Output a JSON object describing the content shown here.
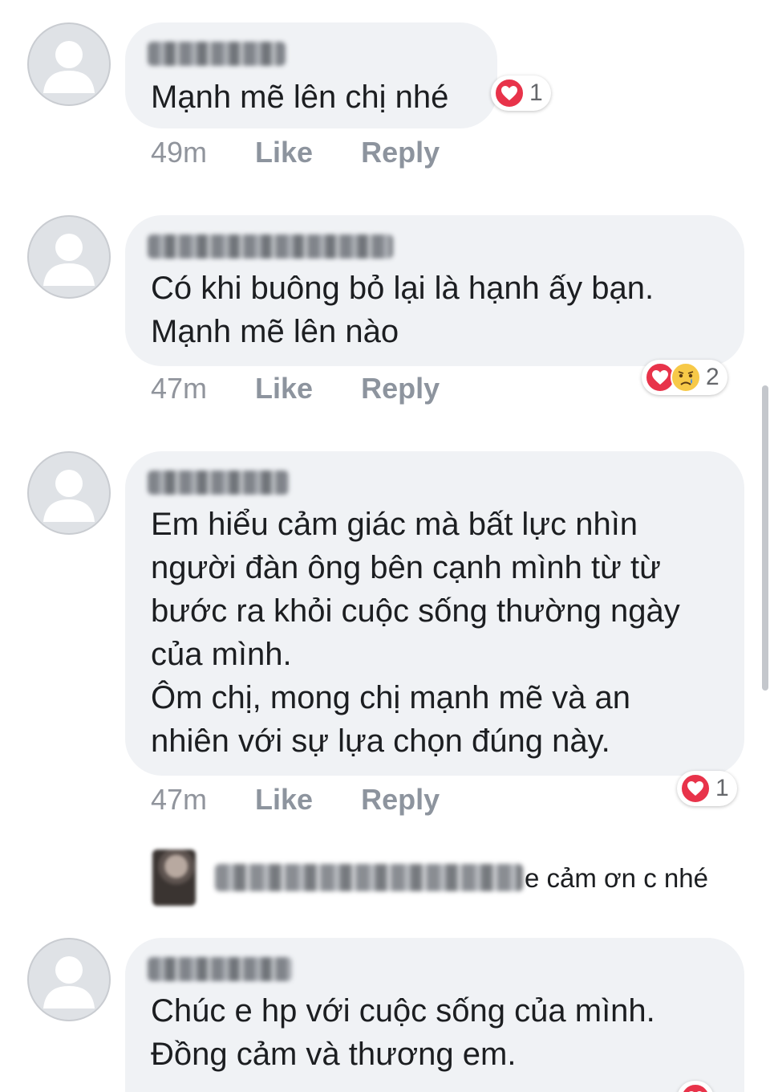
{
  "colors": {
    "bubble_bg": "#f0f2f5",
    "love_red": "#e8334a",
    "sad_yellow": "#f7c948",
    "meta_gray": "#90949c"
  },
  "comments": [
    {
      "text": "Mạnh mẽ lên chị nhé",
      "time": "49m",
      "like_label": "Like",
      "reply_label": "Reply",
      "reactions": [
        "love-icon"
      ],
      "reaction_count": "1"
    },
    {
      "text": "Có khi buông bỏ lại là hạnh ấy bạn.\nMạnh mẽ lên nào",
      "time": "47m",
      "like_label": "Like",
      "reply_label": "Reply",
      "reactions": [
        "love-icon",
        "sad-icon"
      ],
      "reaction_count": "2"
    },
    {
      "text": "Em hiểu cảm giác mà bất lực nhìn\nngười đàn ông bên cạnh mình từ từ\nbước ra khỏi cuộc sống thường ngày\ncủa mình.\nÔm chị, mong chị mạnh mẽ và an\nnhiên với sự lựa chọn đúng này.",
      "time": "47m",
      "like_label": "Like",
      "reply_label": "Reply",
      "reactions": [
        "love-icon"
      ],
      "reaction_count": "1",
      "reply": {
        "text": "e cảm ơn c nhé"
      }
    },
    {
      "text": "Chúc e hp với cuộc sống của mình.\nĐồng cảm và thương em.",
      "reactions": [
        "love-icon"
      ]
    }
  ]
}
